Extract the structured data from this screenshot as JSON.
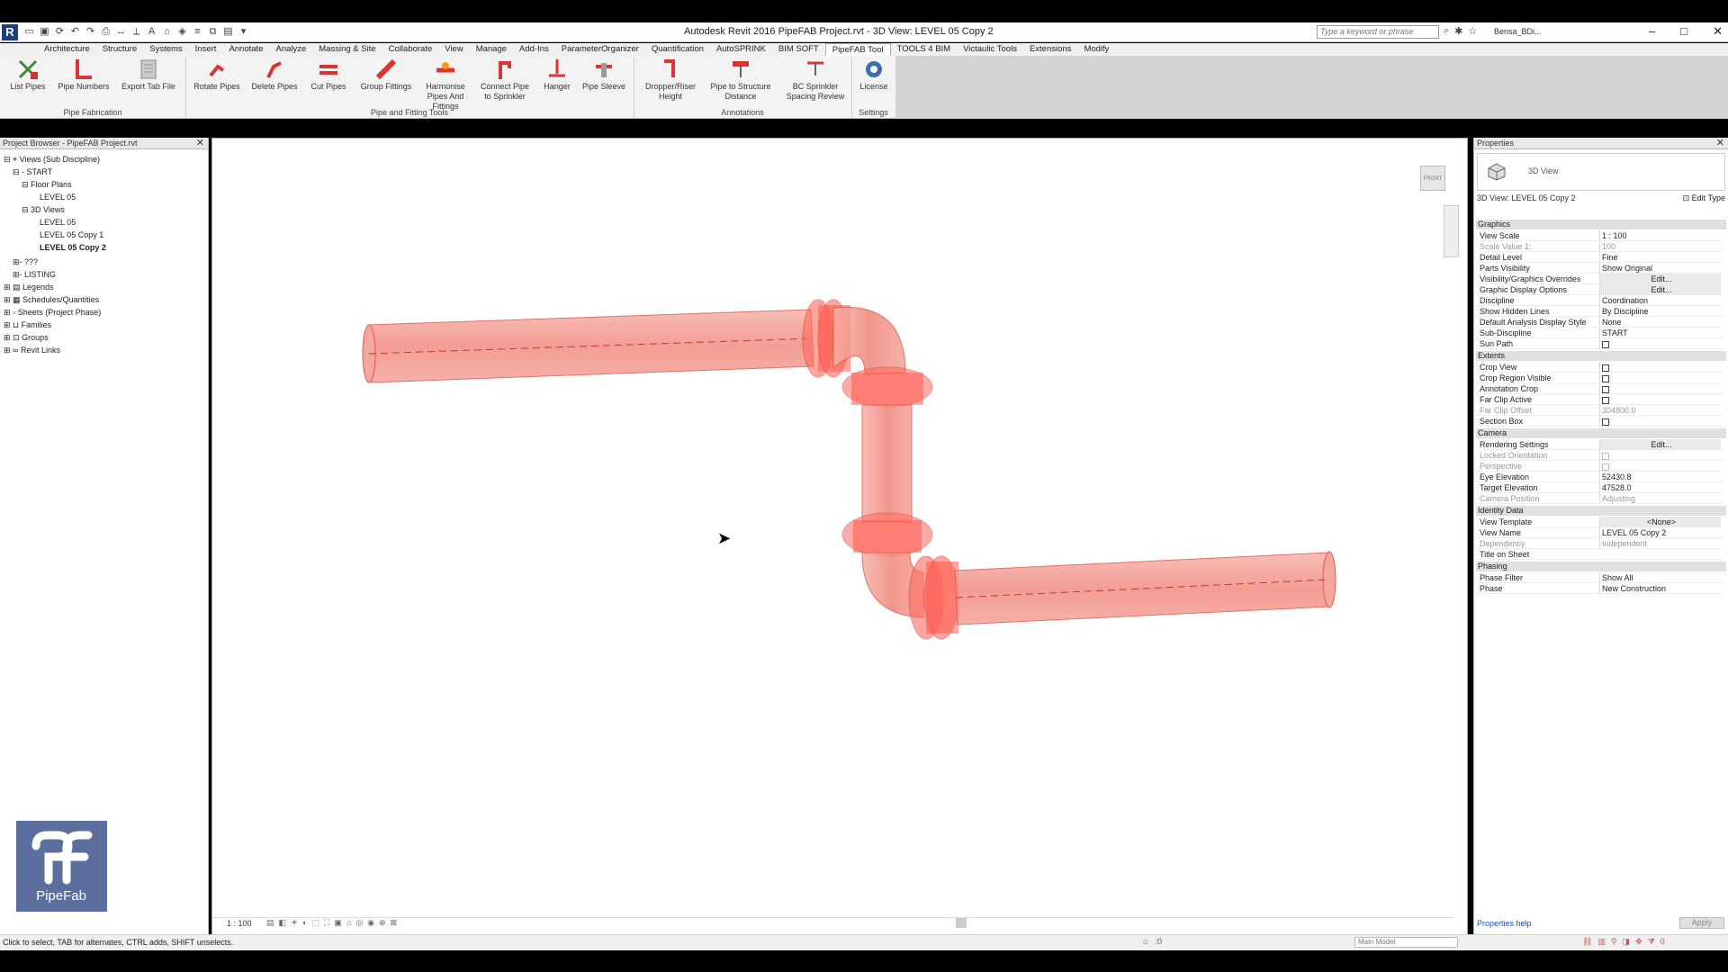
{
  "window": {
    "title": "Autodesk Revit 2016      PipeFAB Project.rvt - 3D View: LEVEL 05 Copy 2",
    "search_placeholder": "Type a keyword or phrase",
    "user": "Bensa_BDi..."
  },
  "tabs": [
    "Architecture",
    "Structure",
    "Systems",
    "Insert",
    "Annotate",
    "Analyze",
    "Massing & Site",
    "Collaborate",
    "View",
    "Manage",
    "Add-Ins",
    "ParameterOrganizer",
    "Quantification",
    "AutoSPRINK",
    "BIM SOFT",
    "PipeFAB Tool",
    "TOOLS 4 BIM",
    "Victaulic Tools",
    "Extensions",
    "Modify"
  ],
  "active_tab": "PipeFAB Tool",
  "ribbon": {
    "buttons": {
      "list_pipes": "List Pipes",
      "pipe_numbers": "Pipe Numbers",
      "export_tab_file": "Export Tab File",
      "rotate_pipes": "Rotate Pipes",
      "delete_pipes": "Delete Pipes",
      "cut_pipes": "Cut Pipes",
      "group_fittings": "Group Fittings",
      "harmonise": "Harmonise Pipes And Fittings",
      "connect_pipe": "Connect Pipe to Sprinkler",
      "hanger": "Hanger",
      "pipe_sleeve": "Pipe Sleeve",
      "dropper_riser": "Dropper/Riser Height",
      "pipe_to_structure": "Pipe to Structure Distance",
      "bc_sprinkler": "BC Sprinkler Spacing Review",
      "license": "License"
    },
    "panels": {
      "pipe_fabrication": "Pipe Fabrication",
      "pipe_fitting_tools": "Pipe and Fitting Tools",
      "annotations": "Annotations",
      "settings": "Settings"
    }
  },
  "project_browser": {
    "title": "Project Browser - PipeFAB Project.rvt",
    "items": {
      "views_root": "Views (Sub Discipline)",
      "start": "START",
      "floor_plans": "Floor Plans",
      "level05": "LEVEL 05",
      "views3d": "3D Views",
      "level05_3d": "LEVEL 05",
      "level05_copy1": "LEVEL 05 Copy 1",
      "level05_copy2": "LEVEL 05 Copy 2",
      "unknown": "???",
      "listing": "LISTING",
      "legends": "Legends",
      "schedules": "Schedules/Quantities",
      "sheets": "Sheets (Project Phase)",
      "families": "Families",
      "groups": "Groups",
      "revit_links": "Revit Links"
    }
  },
  "logo_text": "PipeFab",
  "canvas": {
    "viewcube_label": "FRONT",
    "scale": "1 : 100",
    "pipe_color": "#ff6a5e"
  },
  "properties": {
    "title": "Properties",
    "type_name": "3D View",
    "instance": "3D View: LEVEL 05 Copy 2",
    "edit_type": "Edit Type",
    "sections": {
      "graphics": "Graphics",
      "extents": "Extents",
      "camera": "Camera",
      "identity": "Identity Data",
      "phasing": "Phasing"
    },
    "rows": {
      "view_scale": [
        "View Scale",
        "1 : 100"
      ],
      "scale_value": [
        "Scale Value    1:",
        "100"
      ],
      "detail_level": [
        "Detail Level",
        "Fine"
      ],
      "parts_visibility": [
        "Parts Visibility",
        "Show Original"
      ],
      "vg_overrides": [
        "Visibility/Graphics Overrides",
        "Edit..."
      ],
      "graphic_display": [
        "Graphic Display Options",
        "Edit..."
      ],
      "discipline": [
        "Discipline",
        "Coordination"
      ],
      "hidden_lines": [
        "Show Hidden Lines",
        "By Discipline"
      ],
      "analysis_style": [
        "Default Analysis Display Style",
        "None"
      ],
      "sub_discipline": [
        "Sub-Discipline",
        "START"
      ],
      "sun_path": [
        "Sun Path",
        ""
      ],
      "crop_view": [
        "Crop View",
        ""
      ],
      "crop_region": [
        "Crop Region Visible",
        ""
      ],
      "annotation_crop": [
        "Annotation Crop",
        ""
      ],
      "far_clip_active": [
        "Far Clip Active",
        ""
      ],
      "far_clip_offset": [
        "Far Clip Offset",
        "304800.0"
      ],
      "section_box": [
        "Section Box",
        ""
      ],
      "rendering": [
        "Rendering Settings",
        "Edit..."
      ],
      "locked_orientation": [
        "Locked Orientation",
        ""
      ],
      "perspective": [
        "Perspective",
        ""
      ],
      "eye_elevation": [
        "Eye Elevation",
        "52430.8"
      ],
      "target_elevation": [
        "Target Elevation",
        "47528.0"
      ],
      "camera_position": [
        "Camera Position",
        "Adjusting"
      ],
      "view_template": [
        "View Template",
        "<None>"
      ],
      "view_name": [
        "View Name",
        "LEVEL 05 Copy 2"
      ],
      "dependency": [
        "Dependency",
        "Independent"
      ],
      "title_on_sheet": [
        "Title on Sheet",
        ""
      ],
      "phase_filter": [
        "Phase Filter",
        "Show All"
      ],
      "phase": [
        "Phase",
        "New Construction"
      ]
    },
    "help": "Properties help",
    "apply": "Apply"
  },
  "status": {
    "message": "Click to select, TAB for alternates, CTRL adds, SHIFT unselects.",
    "count": ":0",
    "model": "Main Model",
    "filter_count": "0"
  }
}
